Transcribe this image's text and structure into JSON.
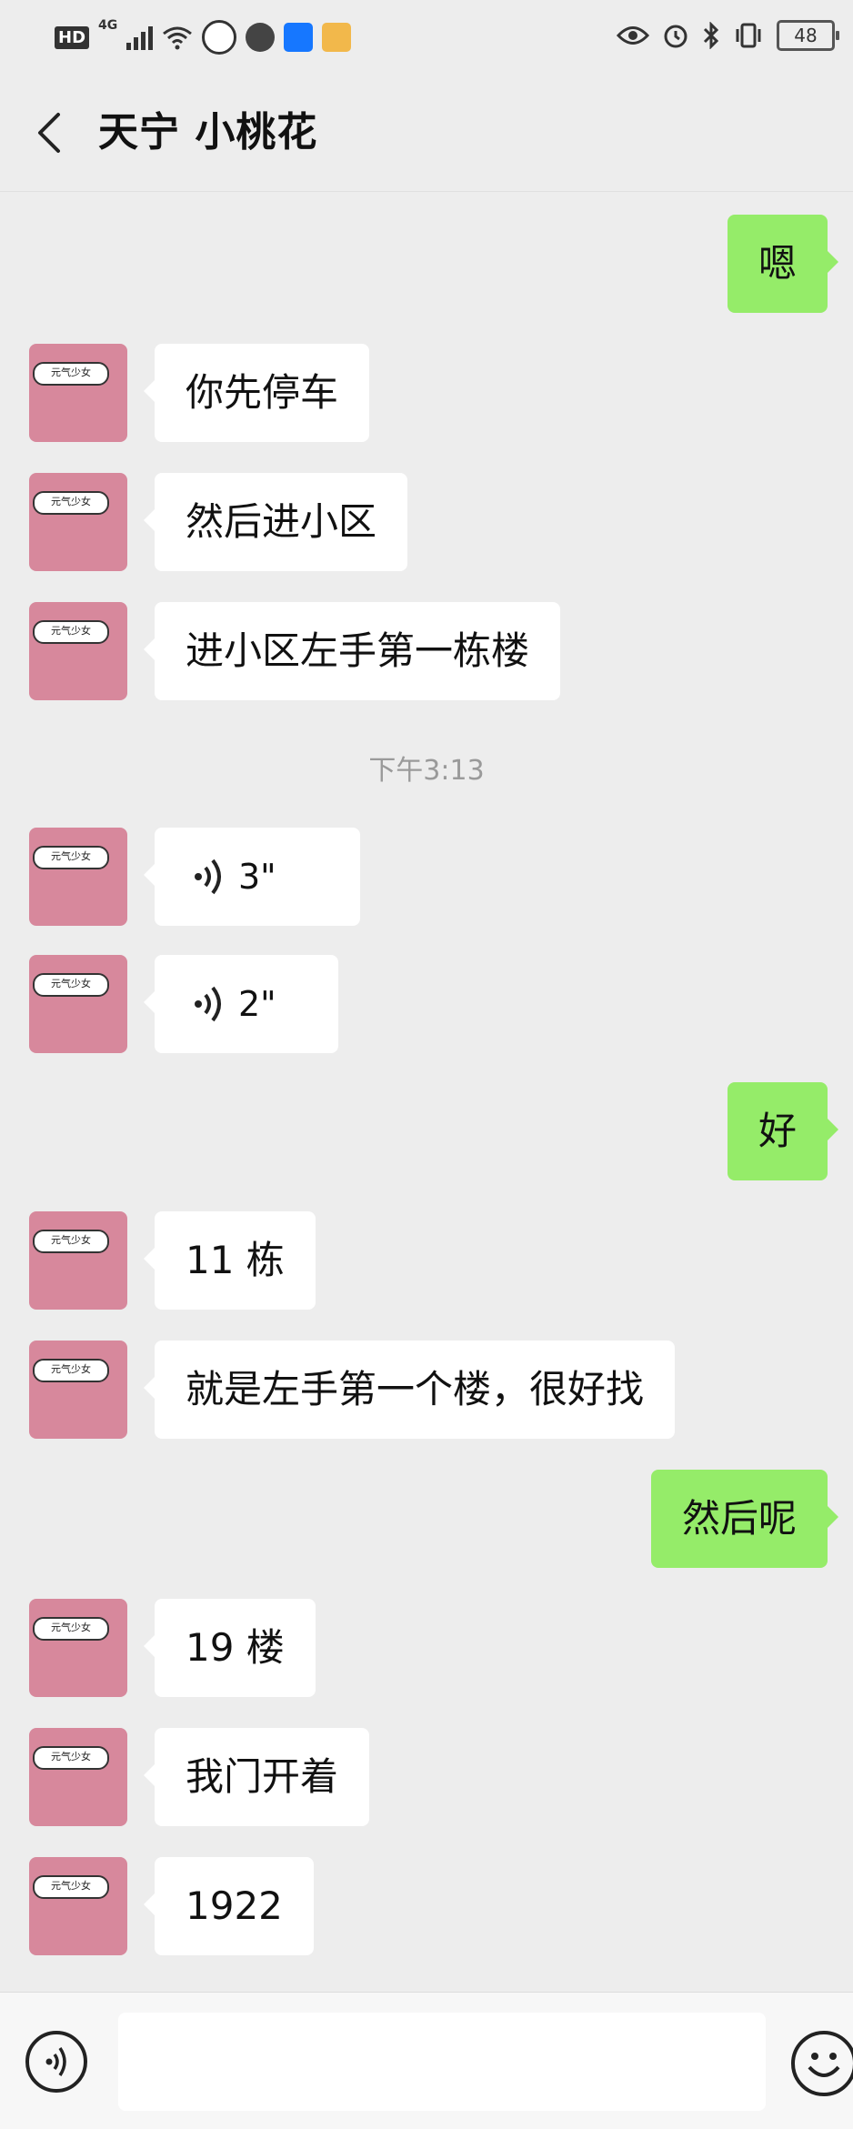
{
  "status_bar": {
    "hd": "HD",
    "network": "4G",
    "battery": "48"
  },
  "header": {
    "title": "天宁 小桃花"
  },
  "avatar_label": "元气少女",
  "messages": [
    {
      "side": "out",
      "text": "嗯"
    },
    {
      "side": "in",
      "text": "你先停车"
    },
    {
      "side": "in",
      "text": "然后进小区"
    },
    {
      "side": "in",
      "text": "进小区左手第一栋楼"
    },
    {
      "side": "in",
      "voice": "3\""
    },
    {
      "side": "in",
      "voice": "2\""
    },
    {
      "side": "out",
      "text": "好"
    },
    {
      "side": "in",
      "text": "11 栋"
    },
    {
      "side": "in",
      "text": "就是左手第一个楼，很好找"
    },
    {
      "side": "out",
      "text": "然后呢"
    },
    {
      "side": "in",
      "text": "19 楼"
    },
    {
      "side": "in",
      "text": "我门开着"
    },
    {
      "side": "in",
      "text": "1922"
    }
  ],
  "timestamp": "下午3:13",
  "input": {
    "value": "",
    "placeholder": ""
  },
  "icons": {
    "back": "back-arrow-icon",
    "voice": "voice-input-icon",
    "emoji": "emoji-icon",
    "play": "voice-play-icon"
  },
  "colors": {
    "background": "#ededed",
    "outgoing_bubble": "#95ec69",
    "incoming_bubble": "#ffffff",
    "avatar": "#d7889c"
  }
}
